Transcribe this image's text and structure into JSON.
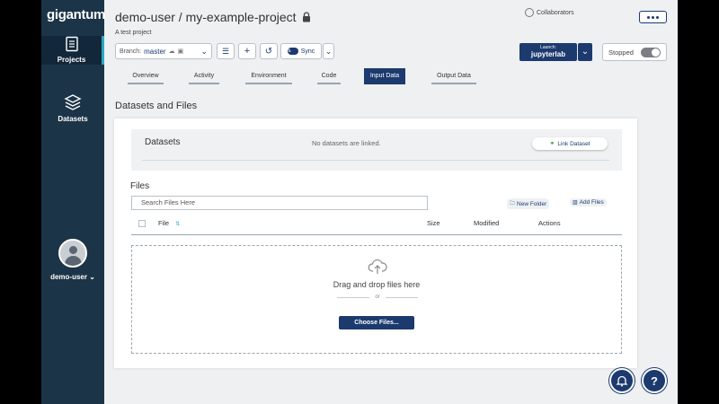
{
  "app": {
    "logo": "gigantum"
  },
  "sidebar": {
    "items": [
      {
        "label": "Projects",
        "icon": "projects-icon"
      },
      {
        "label": "Datasets",
        "icon": "datasets-icon"
      }
    ],
    "user": {
      "name": "demo-user"
    }
  },
  "header": {
    "title": "demo-user / my-example-project",
    "subtitle": "A test project",
    "collaborators_label": "Collaborators"
  },
  "toolbar": {
    "branch_prefix": "Branch:",
    "branch_name": "master",
    "sync_label": "Sync",
    "launch_label": "Launch:",
    "launch_app": "jupyterlab",
    "status_label": "Stopped"
  },
  "tabs": [
    {
      "label": "Overview"
    },
    {
      "label": "Activity"
    },
    {
      "label": "Environment"
    },
    {
      "label": "Code"
    },
    {
      "label": "Input Data"
    },
    {
      "label": "Output Data"
    }
  ],
  "section_title": "Datasets and Files",
  "datasets": {
    "title": "Datasets",
    "empty_text": "No datasets are linked.",
    "link_button": "Link Dataset"
  },
  "files": {
    "title": "Files",
    "search_placeholder": "Search Files Here",
    "new_folder": "New Folder",
    "add_files": "Add Files",
    "columns": [
      "File",
      "Size",
      "Modified",
      "Actions"
    ],
    "dropzone_text": "Drag and drop files here",
    "or_text": "or",
    "choose_button": "Choose Files..."
  },
  "colors": {
    "primary": "#1c3a6e",
    "sidebar": "#1c3447",
    "accent": "#2aa9c4"
  }
}
